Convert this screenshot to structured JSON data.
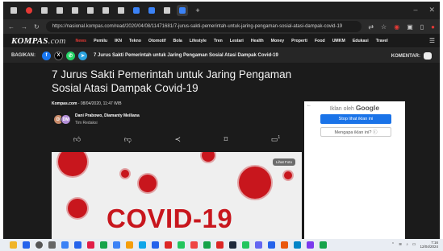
{
  "browser": {
    "url": "https://nasional.kompas.com/read/2020/04/08/11471681/7-jurus-sakti-pemerintah-untuk-jaring-pengaman-sosial-atasi-dampak-covid-19",
    "new_tab": "+",
    "min": "–",
    "close": "✕"
  },
  "site": {
    "logo_main": "KOMPAS",
    "logo_suffix": ".com",
    "nav": [
      "News",
      "Pemilu",
      "IKN",
      "Tekno",
      "Otomotif",
      "Bola",
      "Lifestyle",
      "Tren",
      "Lestari",
      "Health",
      "Money",
      "Properti",
      "Food",
      "UMKM",
      "Edukasi",
      "Travel"
    ],
    "menu_icon": "☰"
  },
  "share_bar": {
    "label": "BAGIKAN:",
    "headline": "7 Jurus Sakti Pemerintah untuk Jaring Pengaman Sosial Atasi Dampak Covid-19",
    "komentar": "KOMENTAR:"
  },
  "article": {
    "title": "7 Jurus Sakti Pemerintah untuk Jaring Pengaman Sosial Atasi Dampak Covid-19",
    "source": "Kompas.com",
    "date": " - 08/04/2020, 11:47 WIB",
    "author_initials": [
      "DI",
      "DM"
    ],
    "authors": "Dani Prabowo, Diamanty Meiliana",
    "role": "Tim Redaksi",
    "comment_count": "1",
    "image_text": "COVID-19",
    "image_badge": "Lihat Foto"
  },
  "ad": {
    "back": "←",
    "by": "Iklan oleh",
    "brand": "Google",
    "stop": "Stop lihat iklan ini",
    "why": "Mengapa iklan ini? ⓘ"
  },
  "taskbar": {
    "time": "7:16",
    "date": "12/04/2024"
  }
}
